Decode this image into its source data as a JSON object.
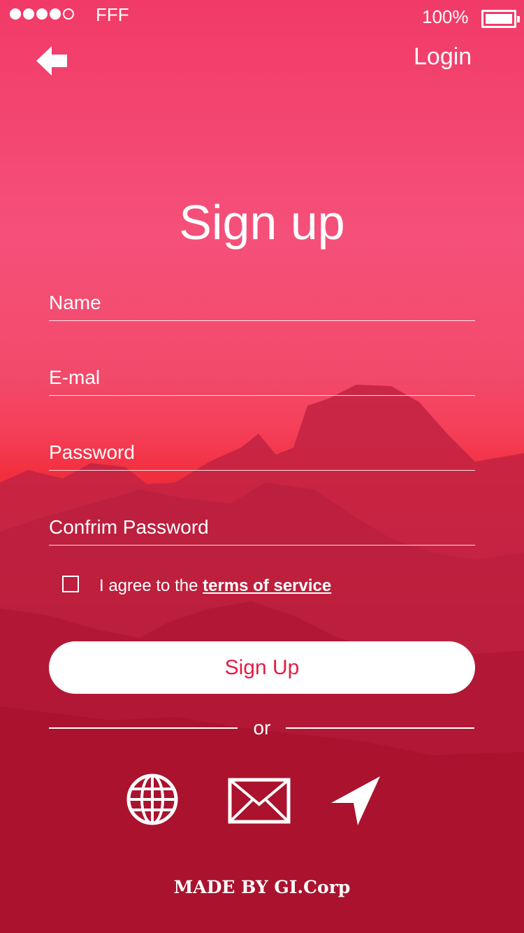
{
  "status_bar": {
    "carrier": "FFF",
    "battery_percent": "100%",
    "signal_bars": 4,
    "signal_total": 5
  },
  "nav": {
    "back_icon": "arrow-left-icon",
    "login_label": "Login"
  },
  "form": {
    "title": "Sign up",
    "fields": [
      {
        "placeholder": "Name",
        "value": ""
      },
      {
        "placeholder": "E-mal",
        "value": ""
      },
      {
        "placeholder": "Password",
        "value": ""
      },
      {
        "placeholder": "Confrim Password",
        "value": ""
      }
    ],
    "agree_text": "I agree to the ",
    "terms_link": "terms of service",
    "agree_checked": false,
    "submit_label": "Sign Up",
    "divider_text": "or"
  },
  "social": [
    {
      "icon": "globe-icon"
    },
    {
      "icon": "mail-icon"
    },
    {
      "icon": "send-icon"
    }
  ],
  "footer": {
    "credit": "MADE BY GI.Corp"
  },
  "colors": {
    "accent": "#e21d45",
    "background_top": "#f13a67",
    "background_bottom": "#a60e2a"
  }
}
